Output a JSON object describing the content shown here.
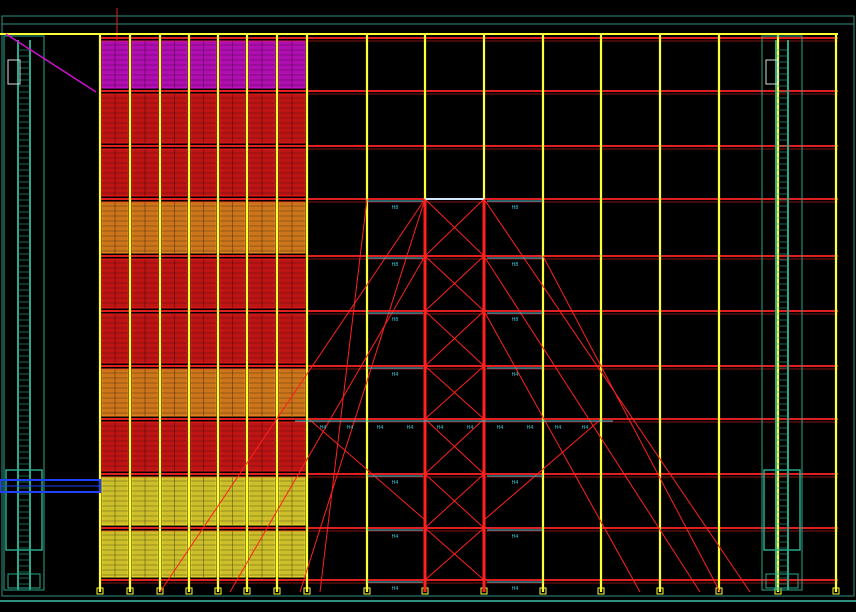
{
  "drawing": {
    "background": "#000000",
    "colors": {
      "frame": "#2f8f7f",
      "column": "#ffff33",
      "beam": "#e02020",
      "pallet_red": "#e01818",
      "pallet_magenta": "#d010d0",
      "pallet_orange": "#f08a20",
      "pallet_yellow": "#f0e030",
      "brace": "#ff2020",
      "crane": "#2aa88a",
      "cyan_label": "#30c0d0",
      "blue": "#2040ff"
    },
    "beam_labels": {
      "upper": "H8",
      "lower": "H4"
    },
    "rack": {
      "bays": 13,
      "levels": 11,
      "storage_bays": 7
    },
    "stored_pallets": [
      {
        "level": 1,
        "kind": "magenta"
      },
      {
        "level": 2,
        "kind": "red"
      },
      {
        "level": 3,
        "kind": "red"
      },
      {
        "level": 4,
        "kind": "orange"
      },
      {
        "level": 5,
        "kind": "red"
      },
      {
        "level": 6,
        "kind": "red"
      },
      {
        "level": 7,
        "kind": "orange"
      },
      {
        "level": 8,
        "kind": "red"
      },
      {
        "level": 9,
        "kind": "yellow"
      },
      {
        "level": 10,
        "kind": "yellow"
      }
    ]
  }
}
